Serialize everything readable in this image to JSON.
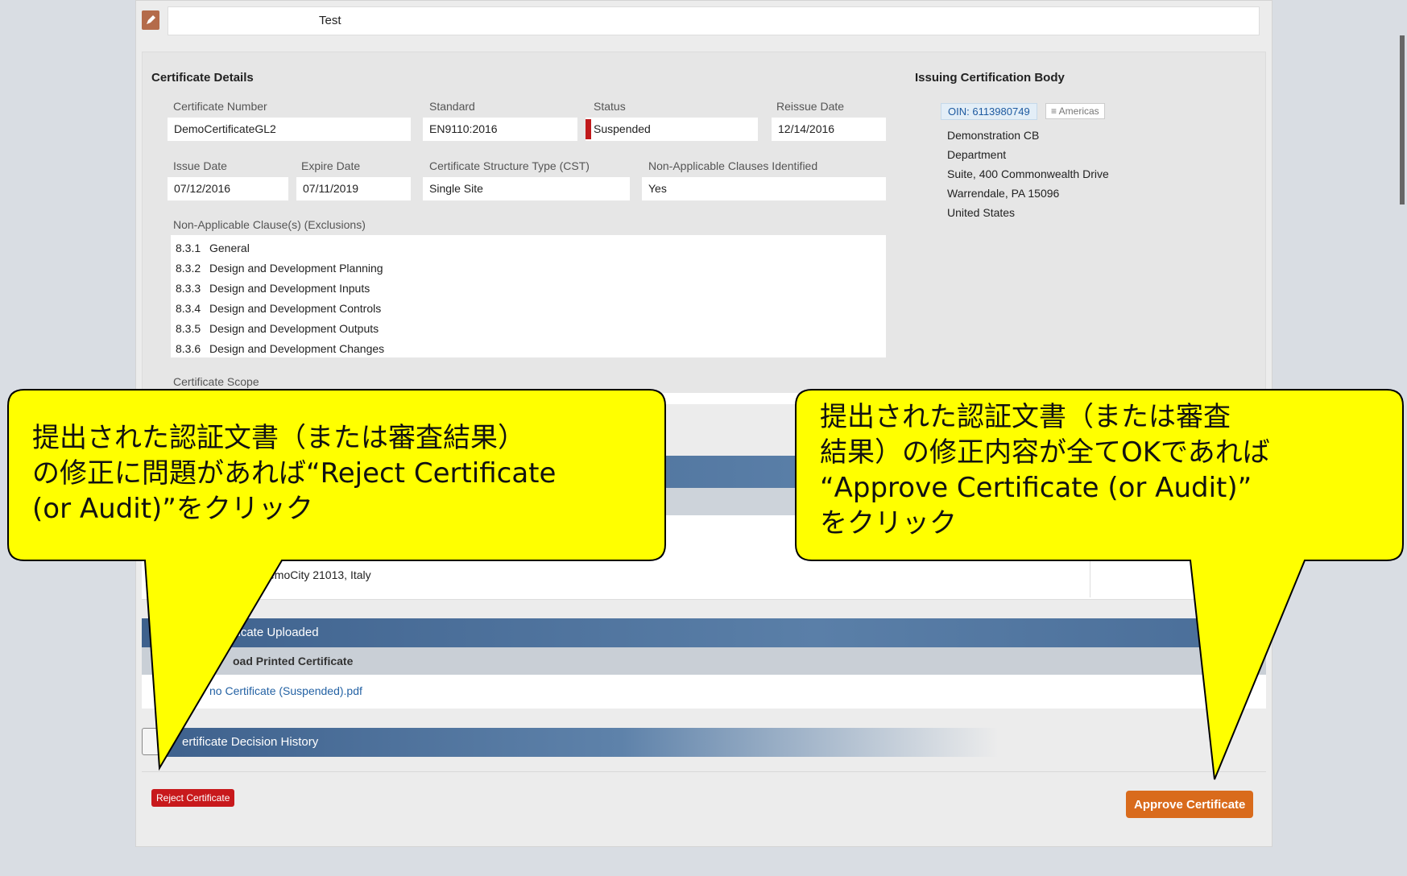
{
  "top_row": {
    "text": "Test"
  },
  "certificate_details": {
    "title": "Certificate Details",
    "fields": {
      "certificate_number": {
        "label": "Certificate Number",
        "value": "DemoCertificateGL2"
      },
      "standard": {
        "label": "Standard",
        "value": "EN9110:2016"
      },
      "status": {
        "label": "Status",
        "value": "Suspended",
        "color": "#c0191b"
      },
      "reissue_date": {
        "label": "Reissue Date",
        "value": "12/14/2016"
      },
      "issue_date": {
        "label": "Issue Date",
        "value": "07/12/2016"
      },
      "expire_date": {
        "label": "Expire Date",
        "value": "07/11/2019"
      },
      "cst": {
        "label": "Certificate Structure Type (CST)",
        "value": "Single Site"
      },
      "nac_identified": {
        "label": "Non-Applicable Clauses Identified",
        "value": "Yes"
      }
    },
    "exclusions_label": "Non-Applicable Clause(s) (Exclusions)",
    "exclusions": [
      {
        "num": "8.3.1",
        "text": "General"
      },
      {
        "num": "8.3.2",
        "text": "Design and Development Planning"
      },
      {
        "num": "8.3.3",
        "text": "Design and Development Inputs"
      },
      {
        "num": "8.3.4",
        "text": "Design and Development Controls"
      },
      {
        "num": "8.3.5",
        "text": "Design and Development Outputs"
      },
      {
        "num": "8.3.6",
        "text": "Design and Development Changes"
      }
    ],
    "scope_label": "Certificate Scope"
  },
  "issuing_body": {
    "title": "Issuing Certification Body",
    "oin": "OIN: 6113980749",
    "region": "≡ Americas",
    "address_lines": [
      "Demonstration CB",
      "Department",
      "Suite, 400 Commonwealth Drive",
      "Warrendale, PA 15096",
      "United States"
    ]
  },
  "site": {
    "address_fragment": "emoCity 21013, Italy"
  },
  "uploaded": {
    "header": "ificate Uploaded",
    "subheader": "oad Printed Certificate",
    "file_link": "no Certificate (Suspended).pdf"
  },
  "decision_history": {
    "header": "ertificate Decision History"
  },
  "buttons": {
    "reject": "Reject Certificate",
    "approve": "Approve Certificate"
  },
  "callouts": {
    "left": "提出された認証文書（または審査結果）\nの修正に問題があれば“Reject Certificate\n(or Audit)”をクリック",
    "right": "提出された認証文書（または審査\n結果）の修正内容が全てOKであれば\n “Approve Certificate (or Audit)”\nをクリック",
    "fill": "#ffff00"
  }
}
